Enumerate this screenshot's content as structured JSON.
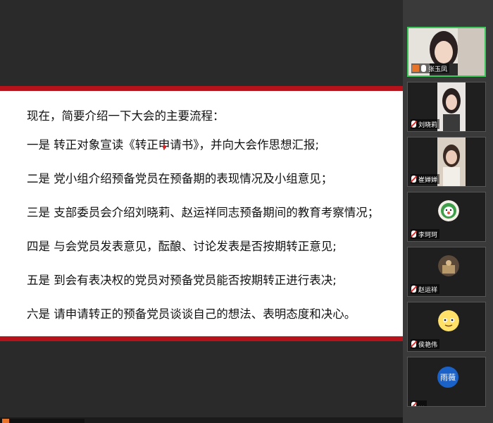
{
  "slide": {
    "lines": [
      "现在，简要介绍一下大会的主要流程：",
      "一是 转正对象宣读《转正申请书》，并向大会作思想汇报;",
      "二是 党小组介绍预备党员在预备期的表现情况及小组意见；",
      "三是 支部委员会介绍刘晓莉、赵运祥同志预备期间的教育考察情况；",
      "四是 与会党员发表意见，酝酿、讨论发表是否按期转正意见;",
      "五是 到会有表决权的党员对预备党员能否按期转正进行表决;",
      "六是 请申请转正的预备党员谈谈自己的想法、表明态度和决心。"
    ]
  },
  "participants": [
    {
      "name": "张玉凤",
      "muted": false,
      "host": true,
      "active": true
    },
    {
      "name": "刘晓莉",
      "muted": true
    },
    {
      "name": "崔婵婵",
      "muted": true
    },
    {
      "name": "李珂珂",
      "muted": true
    },
    {
      "name": "赵运祥",
      "muted": true
    },
    {
      "name": "侯艳伟",
      "muted": true
    },
    {
      "name": "雨薇",
      "muted": true,
      "avatar_text": "雨薇"
    }
  ],
  "colors": {
    "accent_red": "#b5121b",
    "active_border": "#3cc85a",
    "host_orange": "#e8742a"
  }
}
